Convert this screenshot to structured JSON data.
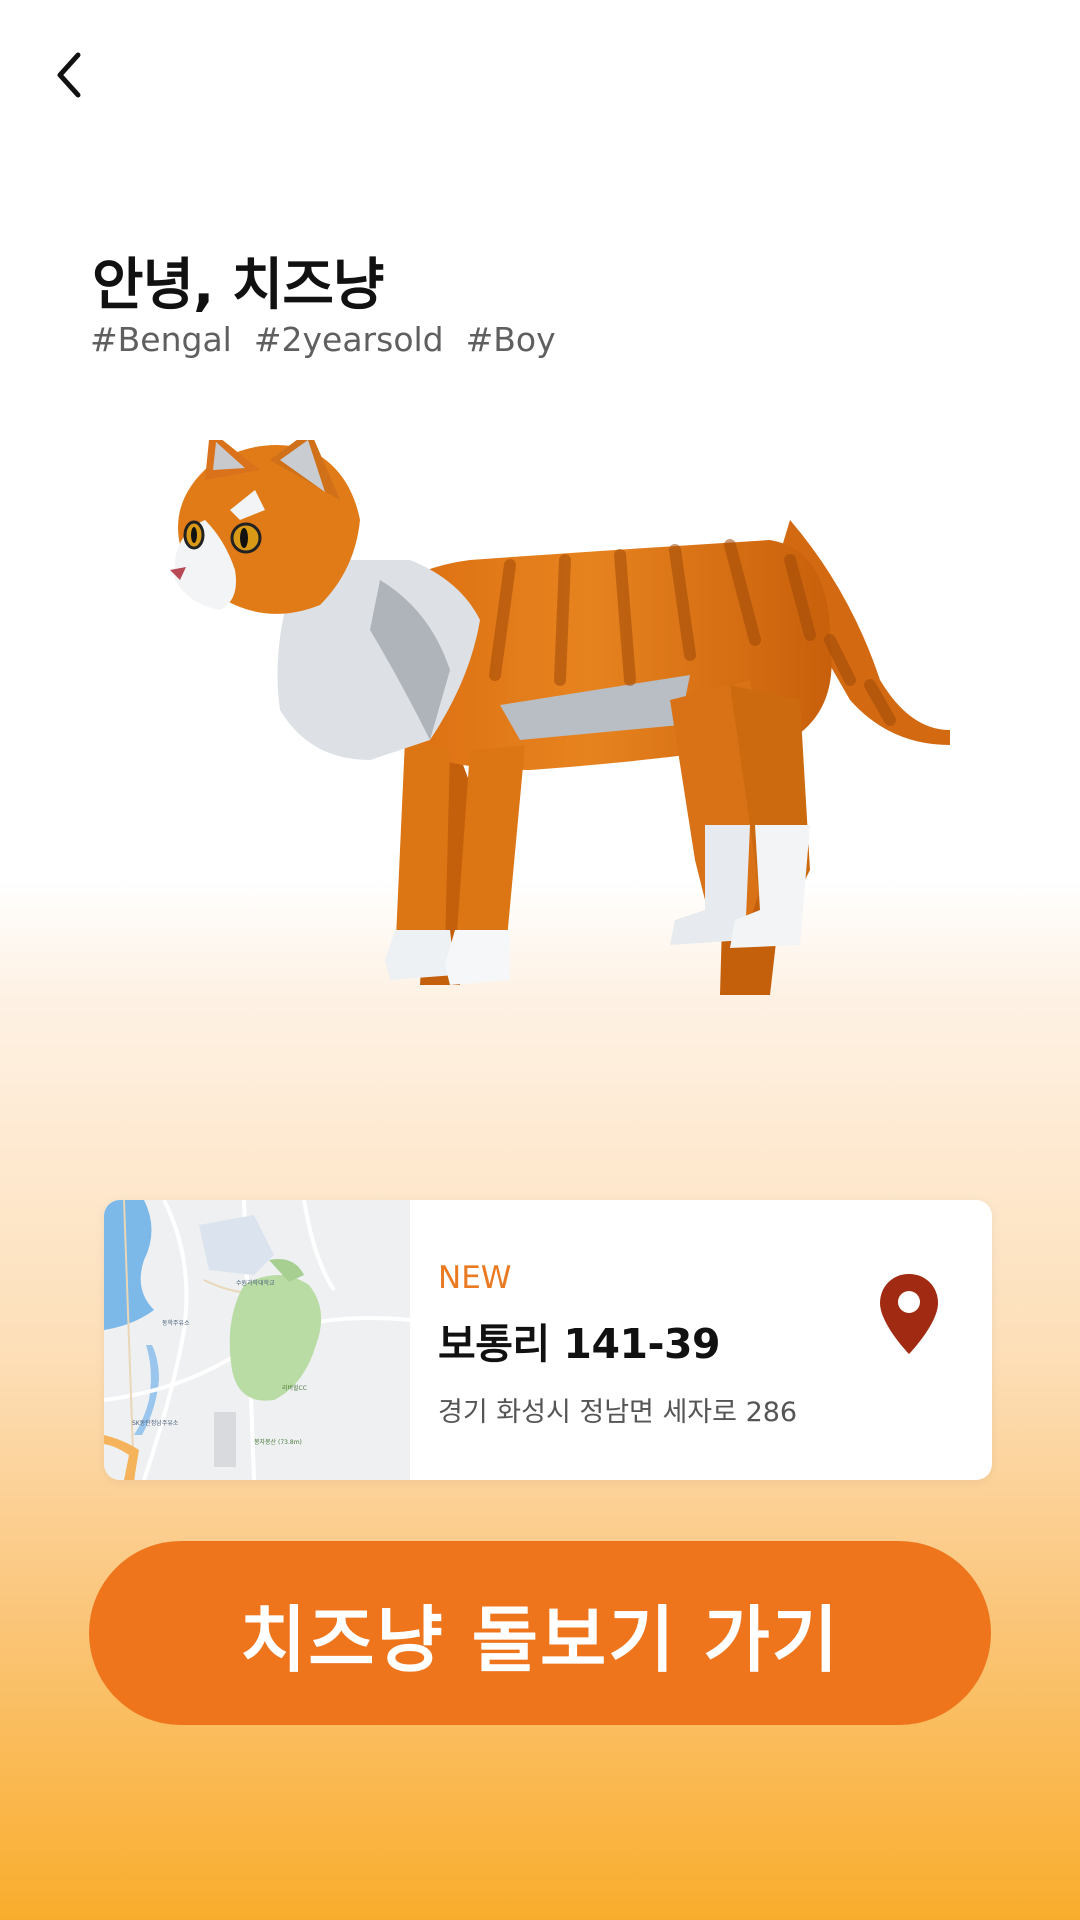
{
  "nav": {
    "back_icon": "chevron-left-icon"
  },
  "profile": {
    "title": "안녕, 치즈냥",
    "tags": [
      "#Bengal",
      "#2yearsold",
      "#Boy"
    ]
  },
  "location": {
    "badge": "NEW",
    "title": "보통리 141-39",
    "address": "경기 화성시 정남면 세자로 286",
    "icon": "map-pin-icon",
    "map_labels": [
      "수원과학대학교",
      "동학주유소",
      "리버힐CC",
      "SK동탄정남주유소",
      "봉자봉산 (73.8m)"
    ]
  },
  "cta": {
    "label": "치즈냥 돌보기 가기"
  },
  "colors": {
    "accent": "#ee751c",
    "pin": "#a12a12",
    "new_badge": "#ea7a22"
  }
}
